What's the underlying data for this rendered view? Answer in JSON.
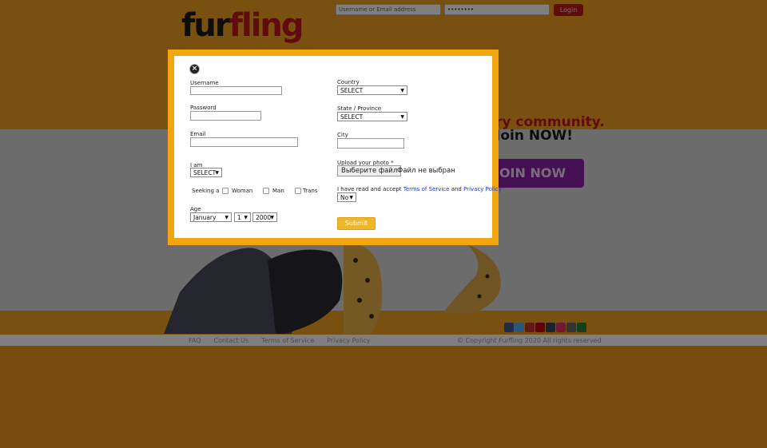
{
  "site": {
    "logo_fur": "fur",
    "logo_fling": "fling",
    "login_username_placeholder": "Username or Email address",
    "login_password_value": "••••••••",
    "login_button": "Login",
    "hero_line1": "ry community.",
    "hero_line2": "Join NOW!",
    "hero_button": "JOIN NOW",
    "footer": {
      "faq": "FAQ",
      "contact": "Contact Us",
      "terms": "Terms of Service",
      "privacy": "Privacy Policy",
      "copyright": "© Copyright Furfling 2020    All rights reserved"
    }
  },
  "modal": {
    "close_icon": "close-icon",
    "username_label": "Username",
    "password_label": "Password",
    "email_label": "Email",
    "iam_label": "I am",
    "iam_value": "SELECT",
    "seeking_label": "Seeking a",
    "seeking_options": [
      "Woman",
      "Man",
      "Trans"
    ],
    "age_label": "Age",
    "age_month": "January",
    "age_day": "1",
    "age_year": "2000",
    "country_label": "Country",
    "country_value": "SELECT",
    "state_label": "State / Province",
    "state_value": "SELECT",
    "city_label": "City",
    "upload_label": "Upload your photo *",
    "file_button": "Выберите файл",
    "file_none": "Файл не выбран",
    "accept_prefix": "I have read and accept ",
    "accept_terms": "Terms of Service",
    "accept_and": " and ",
    "accept_privacy": "Privacy Policy",
    "accept_value": "No",
    "submit_label": "Submit"
  },
  "colors": {
    "modal_border": "#f3a50f",
    "brand_red": "#c0161b",
    "join_purple": "#8a1fa8",
    "submit": "#efb62b",
    "link": "#1a3ec9"
  }
}
